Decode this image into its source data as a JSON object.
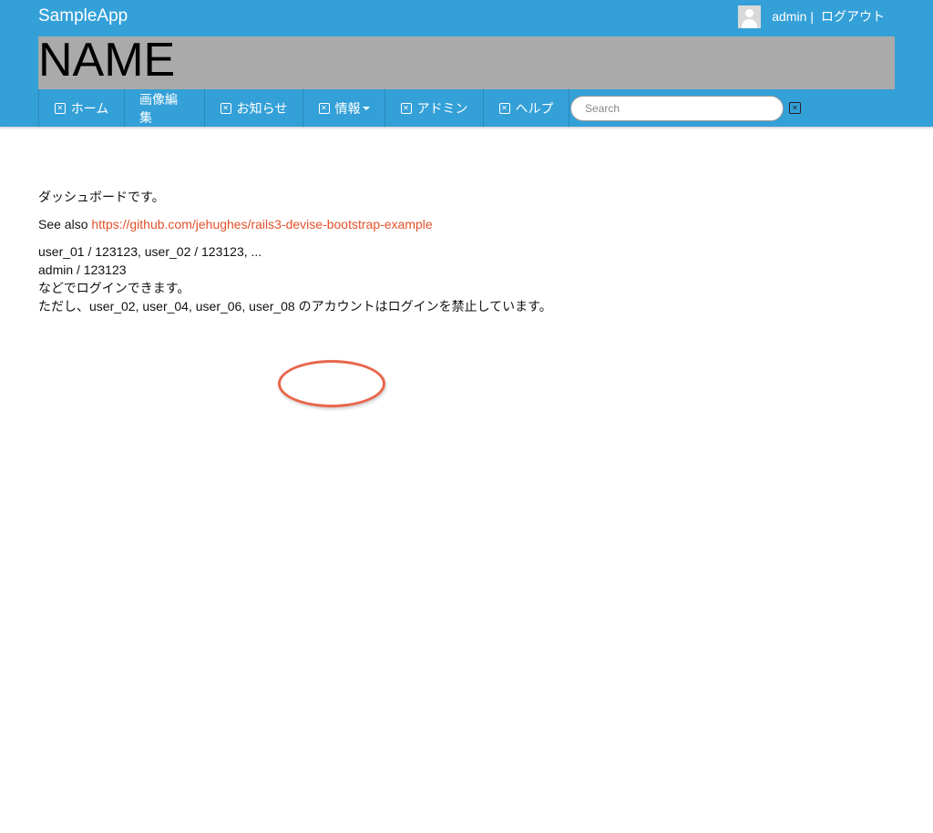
{
  "header": {
    "brand": "SampleApp",
    "username": "admin",
    "separator": "|",
    "logout_label": "ログアウト"
  },
  "banner": {
    "title": "NAME"
  },
  "nav": {
    "items": [
      {
        "label": "ホーム",
        "has_icon": true
      },
      {
        "label": "画像編集",
        "has_icon": false
      },
      {
        "label": "お知らせ",
        "has_icon": true
      },
      {
        "label": "情報",
        "has_icon": true,
        "dropdown": true
      },
      {
        "label": "アドミン",
        "has_icon": true
      },
      {
        "label": "ヘルプ",
        "has_icon": true
      }
    ],
    "search_placeholder": "Search"
  },
  "main": {
    "line1": "ダッシュボードです。",
    "see_also_prefix": "See also ",
    "see_also_link": "https://github.com/jehughes/rails3-devise-bootstrap-example",
    "line3": "user_01 / 123123, user_02 / 123123, ...",
    "line4": "admin / 123123",
    "line5": "などでログインできます。",
    "line6": "ただし、user_02, user_04, user_06, user_08 のアカウントはログインを禁止しています。"
  },
  "colors": {
    "header_bg": "#34a0d8",
    "banner_bg": "#aaaaaa",
    "link": "#e4512b",
    "annotation": "#e8664c"
  }
}
